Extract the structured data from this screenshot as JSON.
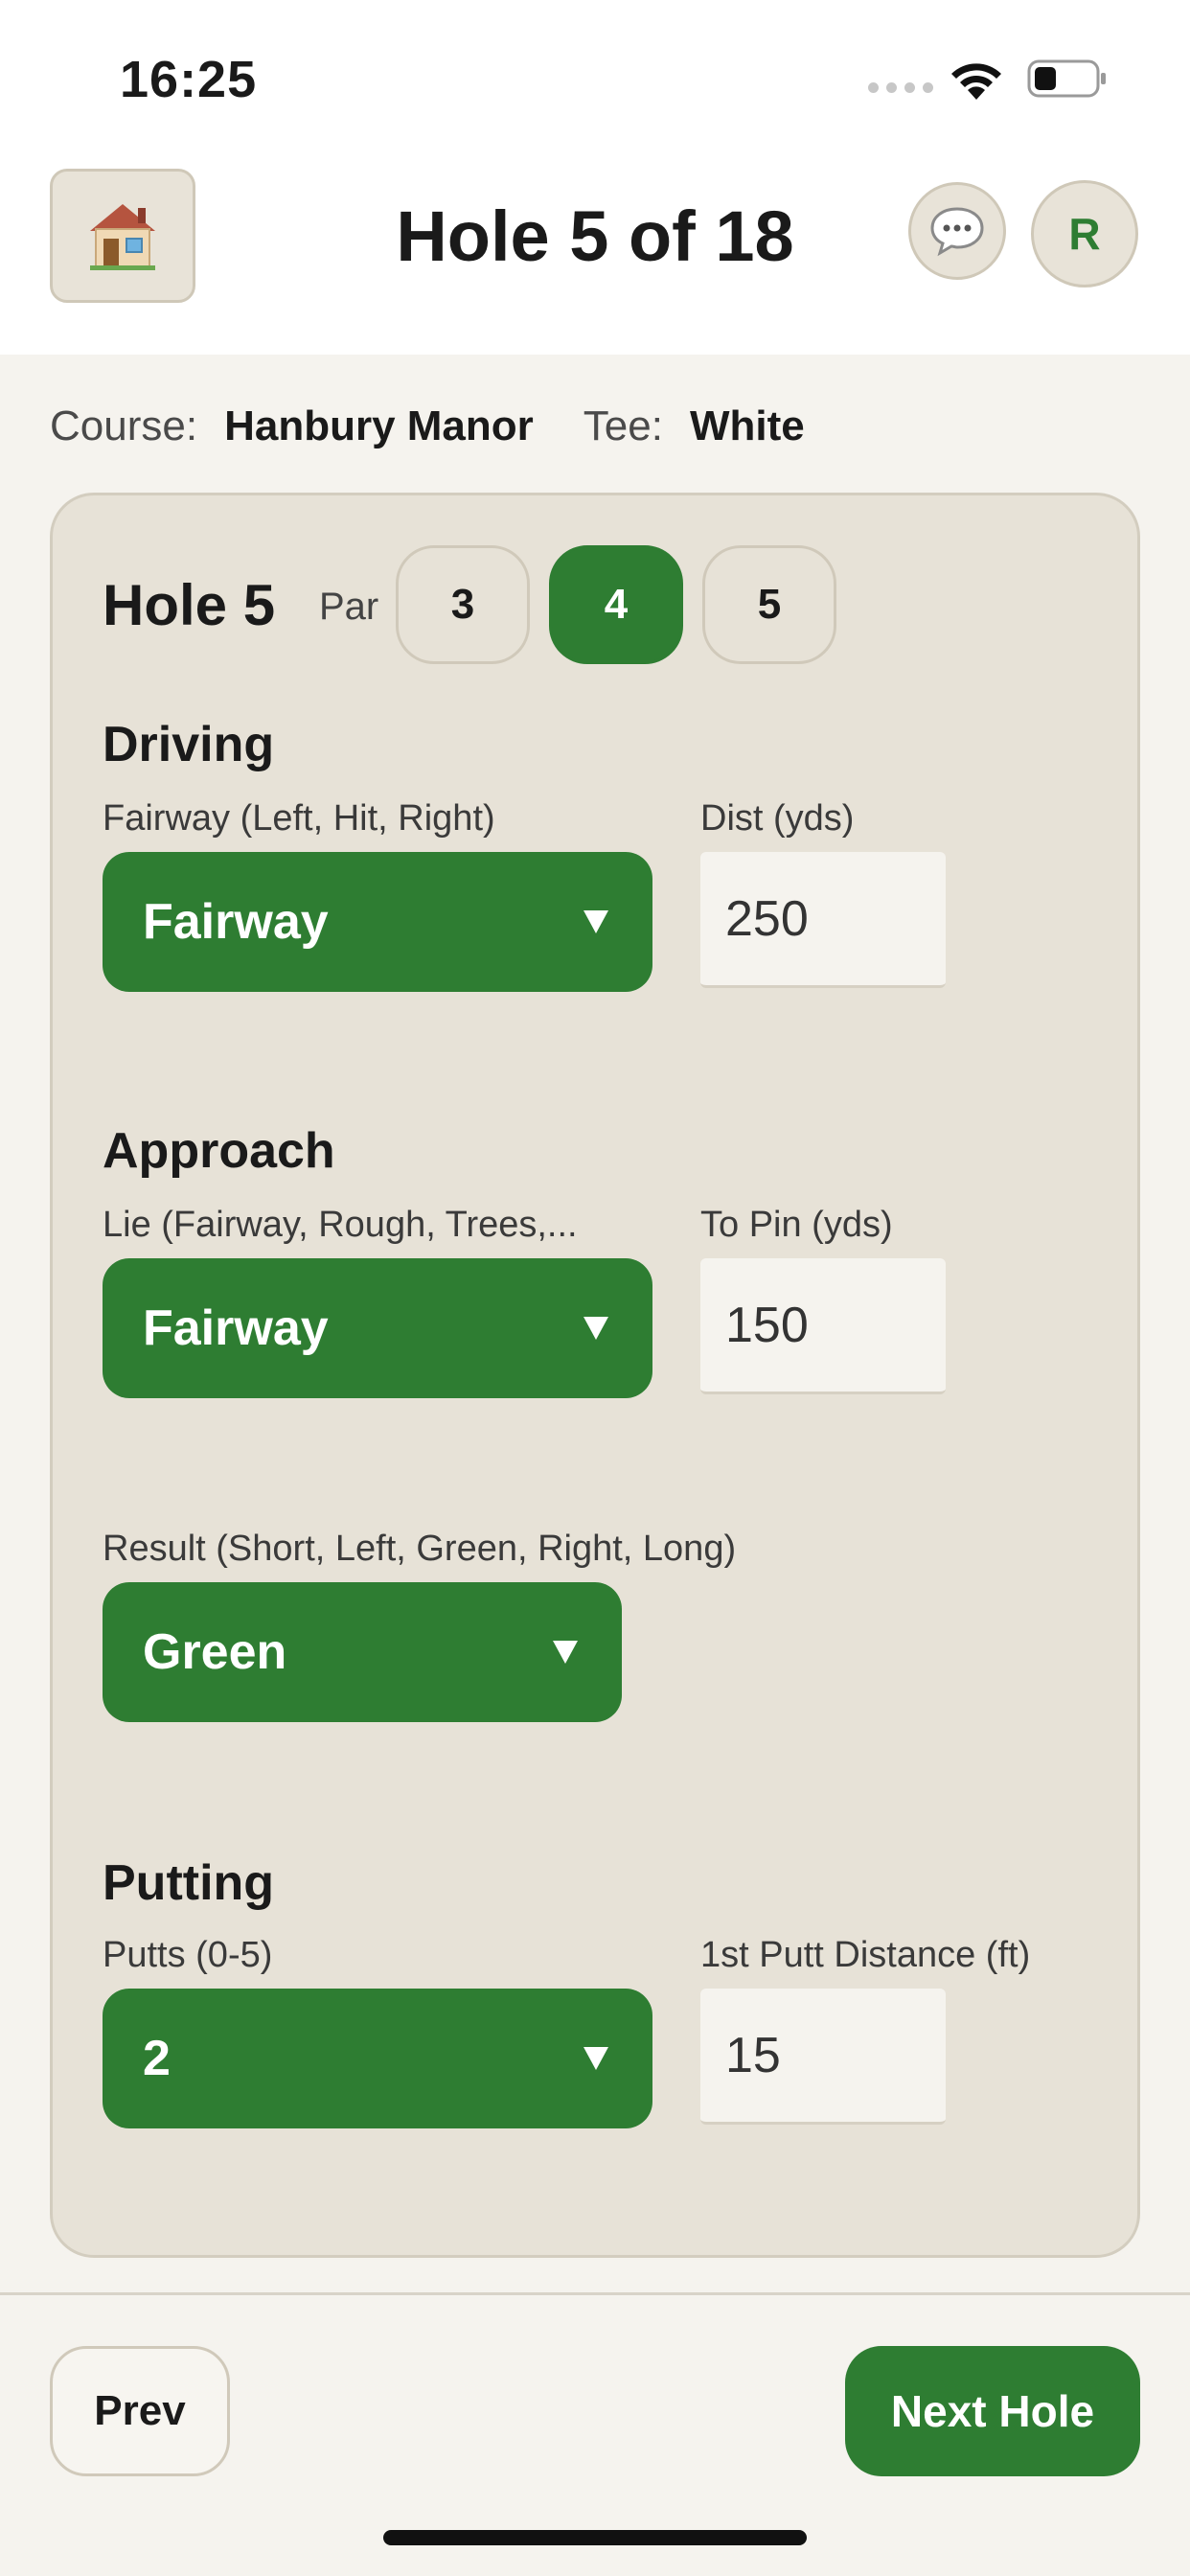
{
  "status_bar": {
    "time": "16:25"
  },
  "header": {
    "title": "Hole 5 of 18",
    "avatar_initial": "R"
  },
  "course_info": {
    "course_label": "Course:",
    "course_name": "Hanbury Manor",
    "tee_label": "Tee:",
    "tee_value": "White"
  },
  "hole": {
    "label": "Hole 5",
    "par_label": "Par",
    "par_options": [
      "3",
      "4",
      "5"
    ],
    "selected_par": "4"
  },
  "driving": {
    "title": "Driving",
    "fairway_label": "Fairway (Left, Hit, Right)",
    "fairway_value": "Fairway",
    "dist_label": "Dist (yds)",
    "dist_value": "250"
  },
  "approach": {
    "title": "Approach",
    "lie_label": "Lie (Fairway, Rough, Trees,...",
    "lie_value": "Fairway",
    "topin_label": "To Pin (yds)",
    "topin_value": "150",
    "result_label": "Result (Short, Left, Green, Right, Long)",
    "result_value": "Green"
  },
  "putting": {
    "title": "Putting",
    "putts_label": "Putts (0-5)",
    "putts_value": "2",
    "first_putt_label": "1st Putt Distance (ft)",
    "first_putt_value": "15"
  },
  "footer": {
    "prev_label": "Prev",
    "next_label": "Next Hole"
  },
  "colors": {
    "accent": "#2e7d32",
    "card": "#e7e2d7",
    "background": "#f5f3ee"
  },
  "icons": {
    "home": "house-icon",
    "chat": "speech-bubble-icon"
  }
}
